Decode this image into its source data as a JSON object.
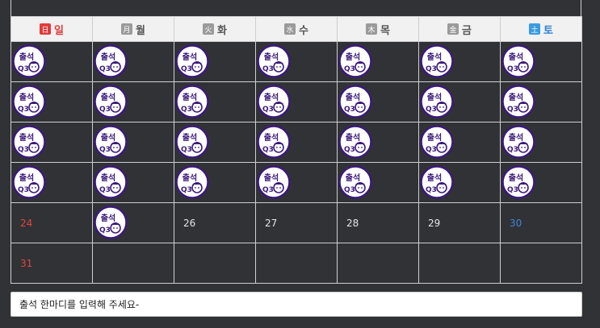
{
  "weekdays": [
    {
      "hanja": "日",
      "label": "일",
      "kind": "sun"
    },
    {
      "hanja": "月",
      "label": "월",
      "kind": "wd"
    },
    {
      "hanja": "火",
      "label": "화",
      "kind": "wd"
    },
    {
      "hanja": "水",
      "label": "수",
      "kind": "wd"
    },
    {
      "hanja": "木",
      "label": "목",
      "kind": "wd"
    },
    {
      "hanja": "金",
      "label": "금",
      "kind": "wd"
    },
    {
      "hanja": "土",
      "label": "토",
      "kind": "sat"
    }
  ],
  "stamp_text": "출석",
  "stamp_mark": "Q3",
  "weeks": [
    [
      {
        "stamp": true
      },
      {
        "stamp": true
      },
      {
        "stamp": true
      },
      {
        "stamp": true
      },
      {
        "stamp": true
      },
      {
        "stamp": true
      },
      {
        "stamp": true
      }
    ],
    [
      {
        "stamp": true
      },
      {
        "stamp": true
      },
      {
        "stamp": true
      },
      {
        "stamp": true
      },
      {
        "stamp": true
      },
      {
        "stamp": true
      },
      {
        "stamp": true
      }
    ],
    [
      {
        "stamp": true
      },
      {
        "stamp": true
      },
      {
        "stamp": true
      },
      {
        "stamp": true
      },
      {
        "stamp": true
      },
      {
        "stamp": true
      },
      {
        "stamp": true
      }
    ],
    [
      {
        "stamp": true
      },
      {
        "stamp": true
      },
      {
        "stamp": true
      },
      {
        "stamp": true
      },
      {
        "stamp": true
      },
      {
        "stamp": true
      },
      {
        "stamp": true
      }
    ],
    [
      {
        "day": "24"
      },
      {
        "stamp": true
      },
      {
        "day": "26"
      },
      {
        "day": "27"
      },
      {
        "day": "28"
      },
      {
        "day": "29"
      },
      {
        "day": "30"
      }
    ],
    [
      {
        "day": "31"
      },
      {},
      {},
      {},
      {},
      {},
      {}
    ]
  ],
  "comment": {
    "value": "출석 한마디를 입력해 주세요-"
  },
  "colors": {
    "stamp_ring": "#3b1a7a",
    "sunday": "#e0453f",
    "saturday": "#3f85d6",
    "background": "#313236"
  }
}
